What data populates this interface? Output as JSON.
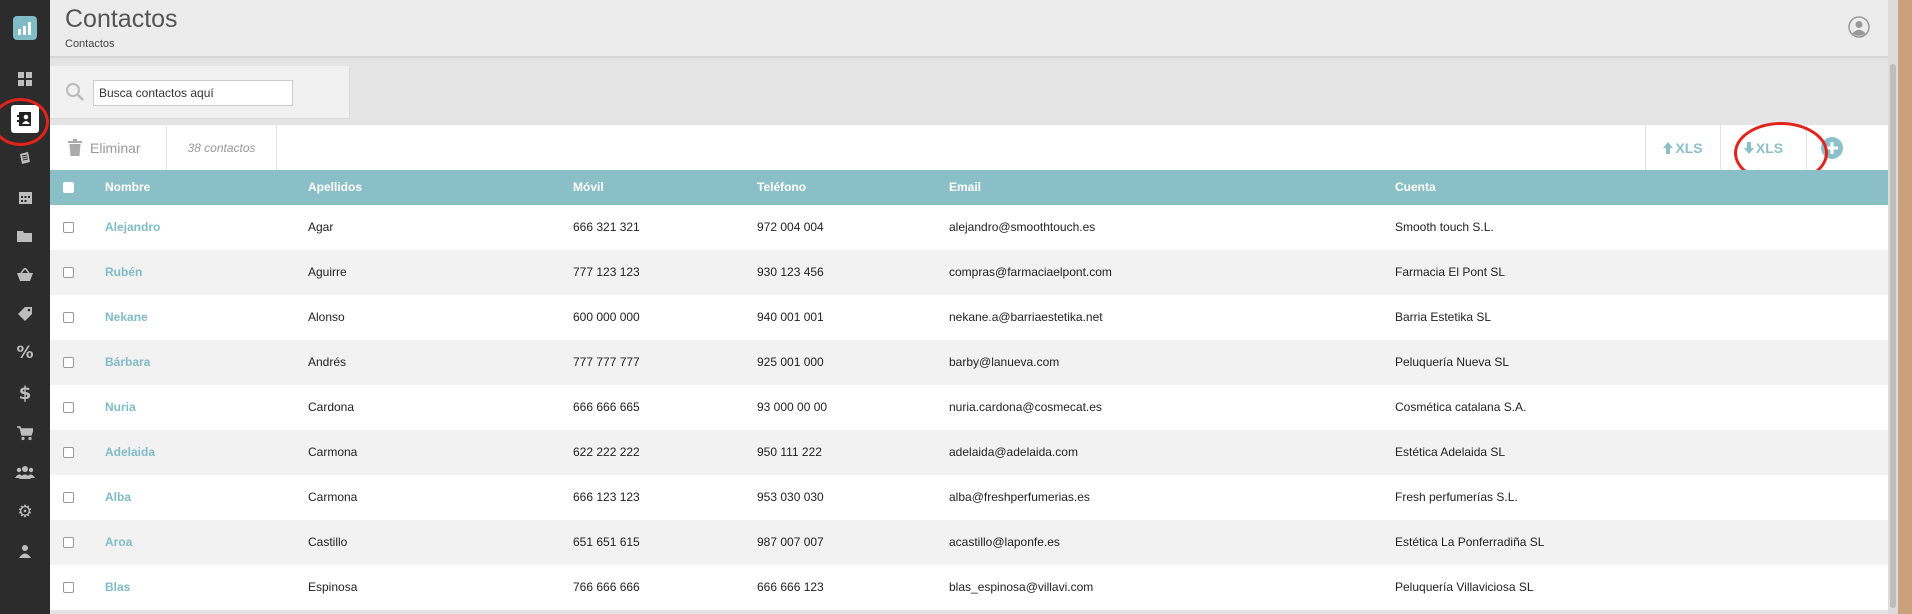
{
  "header": {
    "title": "Contactos",
    "breadcrumb": "Contactos"
  },
  "search": {
    "placeholder": "Busca contactos aquí"
  },
  "toolbar": {
    "delete_label": "Eliminar",
    "count_label": "38 contactos",
    "import_label": "XLS",
    "export_label": "XLS"
  },
  "sidebar": {
    "items": [
      {
        "icon": "dashboard-icon"
      },
      {
        "icon": "contacts-icon",
        "active": true
      },
      {
        "icon": "notes-icon"
      },
      {
        "icon": "calendar-icon"
      },
      {
        "icon": "folder-icon"
      },
      {
        "icon": "basket-icon"
      },
      {
        "icon": "tag-icon"
      },
      {
        "icon": "percent-icon"
      },
      {
        "icon": "dollar-icon"
      },
      {
        "icon": "cart-icon"
      },
      {
        "icon": "users-icon"
      },
      {
        "icon": "gear-icon"
      },
      {
        "icon": "user-icon"
      }
    ]
  },
  "table": {
    "columns": [
      "Nombre",
      "Apellidos",
      "Móvil",
      "Teléfono",
      "Email",
      "Cuenta"
    ],
    "rows": [
      {
        "name": "Alejandro",
        "surname": "Agar",
        "mobile": "666 321 321",
        "phone": "972 004 004",
        "email": "alejandro@smoothtouch.es",
        "account": "Smooth touch S.L."
      },
      {
        "name": "Rubén",
        "surname": "Aguirre",
        "mobile": "777 123 123",
        "phone": "930 123 456",
        "email": "compras@farmaciaelpont.com",
        "account": "Farmacia El Pont SL"
      },
      {
        "name": "Nekane",
        "surname": "Alonso",
        "mobile": "600 000 000",
        "phone": "940 001 001",
        "email": "nekane.a@barriaestetika.net",
        "account": "Barria Estetika SL"
      },
      {
        "name": "Bárbara",
        "surname": "Andrés",
        "mobile": "777 777 777",
        "phone": "925 001 000",
        "email": "barby@lanueva.com",
        "account": "Peluquería Nueva SL"
      },
      {
        "name": "Nuria",
        "surname": "Cardona",
        "mobile": "666 666 665",
        "phone": "93 000 00 00",
        "email": "nuria.cardona@cosmecat.es",
        "account": "Cosmética catalana S.A."
      },
      {
        "name": "Adelaida",
        "surname": "Carmona",
        "mobile": "622 222 222",
        "phone": "950 111 222",
        "email": "adelaida@adelaida.com",
        "account": "Estética Adelaida SL"
      },
      {
        "name": "Alba",
        "surname": "Carmona",
        "mobile": "666 123 123",
        "phone": "953 030 030",
        "email": "alba@freshperfumerias.es",
        "account": "Fresh perfumerías S.L."
      },
      {
        "name": "Aroa",
        "surname": "Castillo",
        "mobile": "651 651 615",
        "phone": "987 007 007",
        "email": "acastillo@laponfe.es",
        "account": "Estética La Ponferradiña SL"
      },
      {
        "name": "Blas",
        "surname": "Espinosa",
        "mobile": "766 666 666",
        "phone": "666 666 123",
        "email": "blas_espinosa@villavi.com",
        "account": "Peluquería Villaviciosa SL"
      }
    ]
  },
  "colors": {
    "sidebar": "#2c2c2c",
    "accent": "#8bbfc7",
    "annotation": "#e0231b"
  }
}
